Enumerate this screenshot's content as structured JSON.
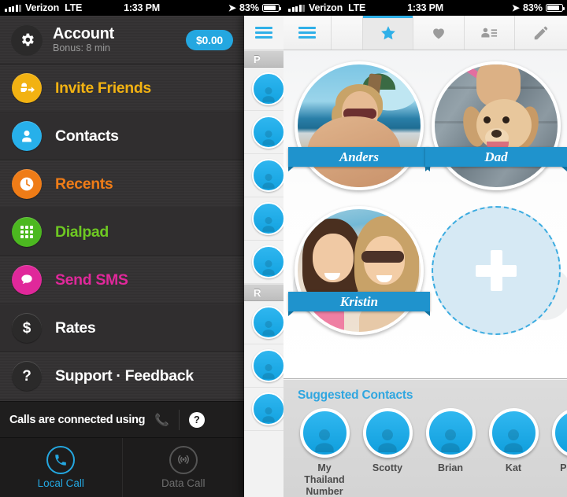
{
  "status_bar": {
    "carrier": "Verizon",
    "network": "LTE",
    "time": "1:33 PM",
    "battery": "83%",
    "location_icon": "location-arrow-icon"
  },
  "left_panel": {
    "account": {
      "gear_icon": "gear-icon",
      "title": "Account",
      "subtitle": "Bonus: 8 min",
      "balance": "$0.00",
      "balance_color": "#24a7e0"
    },
    "menu_items": [
      {
        "label": "Invite Friends",
        "icon": "invite-friends-icon",
        "icon_bg": "#f2b212",
        "text_color": "#f2b212"
      },
      {
        "label": "Contacts",
        "icon": "contacts-person-icon",
        "icon_bg": "#27b0ea",
        "text_color": "#ffffff"
      },
      {
        "label": "Recents",
        "icon": "clock-icon",
        "icon_bg": "#ef7c17",
        "text_color": "#ef7c17"
      },
      {
        "label": "Dialpad",
        "icon": "dialpad-grid-icon",
        "icon_bg": "#4cb820",
        "text_color": "#6ec822"
      },
      {
        "label": "Send SMS",
        "icon": "chat-bubble-icon",
        "icon_bg": "#e0289a",
        "text_color": "#e0289a"
      },
      {
        "label": "Rates",
        "icon": "dollar-icon",
        "icon_bg": "#2b2a2a",
        "text_color": "#ffffff"
      },
      {
        "label": "Support · Feedback",
        "icon": "question-mark-icon",
        "icon_bg": "#2b2a2a",
        "text_color": "#ffffff"
      }
    ],
    "connection_bar": {
      "text": "Calls are connected using",
      "phone_icon": "phone-handset-icon",
      "help_icon": "?"
    },
    "call_modes": [
      {
        "label": "Local Call",
        "icon": "phone-handset-icon",
        "active": true,
        "color": "#24a7e0"
      },
      {
        "label": "Data Call",
        "icon": "wifi-broadcast-icon",
        "active": false,
        "color": "#6d6d6d"
      }
    ]
  },
  "peek_panel": {
    "menu_icon": "hamburger-menu-icon",
    "sections": [
      {
        "letter": "P",
        "rows": 5
      },
      {
        "letter": "R",
        "rows": 3
      }
    ]
  },
  "right_panel": {
    "tabs": [
      {
        "name": "menu",
        "icon": "hamburger-menu-icon",
        "active": false
      },
      {
        "name": "favorites",
        "icon": "star-icon",
        "active": true
      },
      {
        "name": "likes",
        "icon": "heart-icon",
        "active": false
      },
      {
        "name": "contacts",
        "icon": "contact-card-icon",
        "active": false
      },
      {
        "name": "compose",
        "icon": "pencil-icon",
        "active": false
      }
    ],
    "favorites": [
      {
        "name": "Anders",
        "photo": "ph-anders"
      },
      {
        "name": "Dad",
        "photo": "ph-dad"
      },
      {
        "name": "Kristin",
        "photo": "ph-kristin"
      }
    ],
    "add_favorite": {
      "label": "+",
      "name": "add-favorite-button"
    },
    "suggested": {
      "title": "Suggested Contacts",
      "contacts": [
        {
          "name": "My Thailand\nNumber"
        },
        {
          "name": "Scotty"
        },
        {
          "name": "Brian"
        },
        {
          "name": "Kat"
        },
        {
          "name": "Patrick"
        }
      ]
    }
  }
}
